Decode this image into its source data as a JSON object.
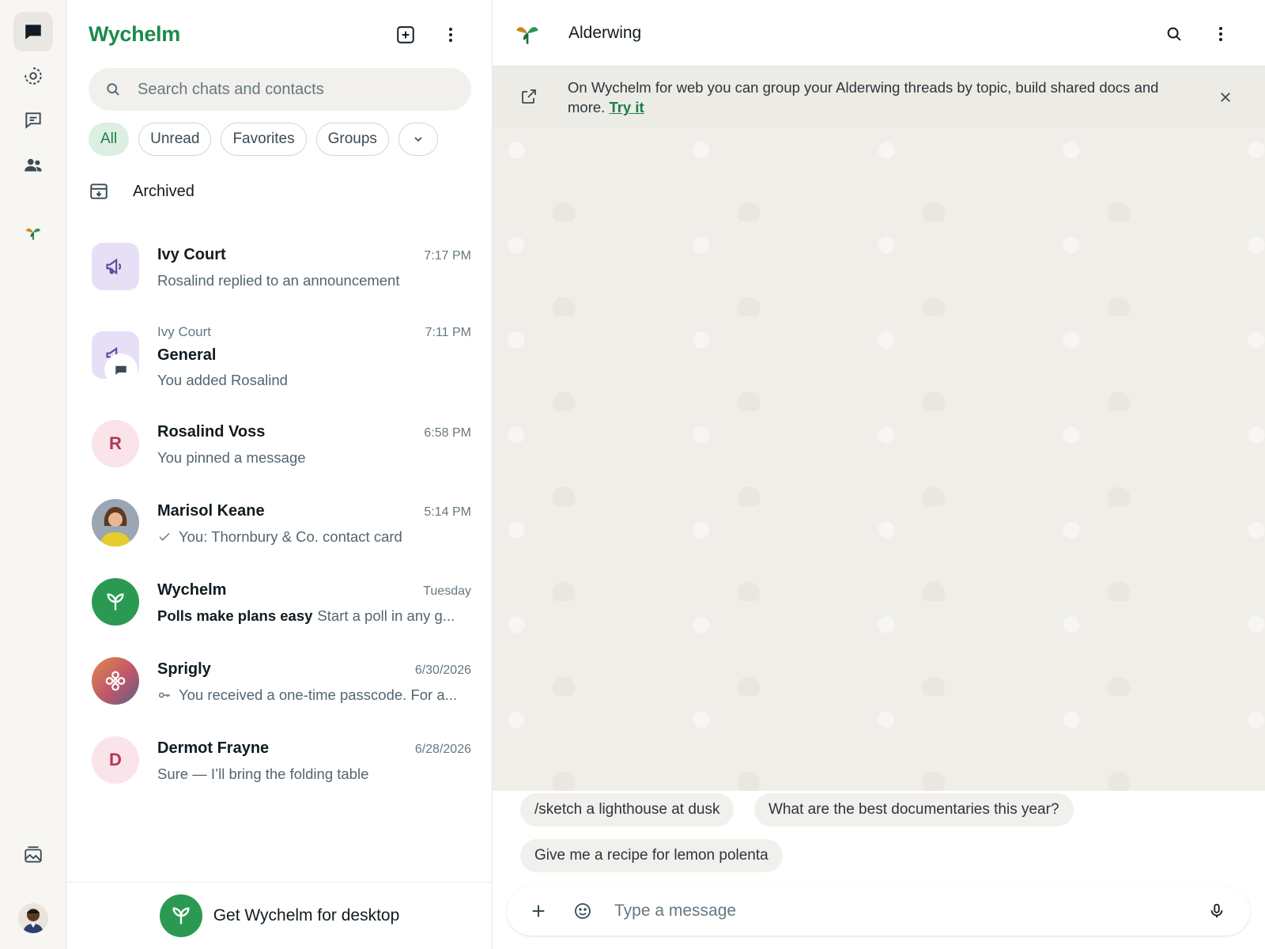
{
  "app": {
    "name": "Wychelm"
  },
  "rail": {
    "items": [
      "chats-icon",
      "status-icon",
      "channels-icon",
      "communities-icon",
      "alderwing-icon"
    ],
    "bottom": [
      "media-icon",
      "profile-avatar"
    ]
  },
  "list": {
    "search_placeholder": "Search chats and contacts",
    "filters": [
      "All",
      "Unread",
      "Favorites",
      "Groups"
    ],
    "archived_label": "Archived",
    "chats": [
      {
        "name": "Ivy Court",
        "time": "7:17 PM",
        "preview": "Rosalind replied to an announcement",
        "avatar": "megaphone-icon"
      },
      {
        "overline": "Ivy Court",
        "name": "General",
        "time": "7:11 PM",
        "preview": "You added Rosalind",
        "avatar": "group-chat-icon"
      },
      {
        "name": "Rosalind Voss",
        "time": "6:58 PM",
        "preview": "You pinned a message",
        "initial": "R"
      },
      {
        "name": "Marisol Keane",
        "time": "5:14 PM",
        "preview": "You: Thornbury & Co. contact card",
        "avatar": "photo-avatar"
      },
      {
        "name": "Wychelm",
        "time": "Tuesday",
        "preview_bold": "Polls make plans easy",
        "preview": "Start a poll in any g...",
        "avatar": "sprout-icon"
      },
      {
        "name": "Sprigly",
        "time": "6/30/2026",
        "preview": "You received a one-time passcode. For a...",
        "avatar": "flower-icon"
      },
      {
        "name": "Dermot Frayne",
        "time": "6/28/2026",
        "preview": "Sure — I’ll bring the folding table",
        "initial": "D"
      }
    ],
    "desktop_cta": "Get Wychelm for desktop"
  },
  "conversation": {
    "title": "Alderwing",
    "banner": {
      "text": "On Wychelm for web you can group your Alderwing threads by topic, build shared docs and more.",
      "link": "Try it"
    },
    "suggestions": [
      "/sketch a lighthouse at dusk",
      "What are the best documentaries this year?",
      "Give me a recipe for lemon polenta"
    ],
    "composer_placeholder": "Type a message"
  },
  "colors": {
    "brand": "#1b8a4a",
    "active_chip_bg": "#dcefe2",
    "wallpaper": "#f0eee8"
  }
}
